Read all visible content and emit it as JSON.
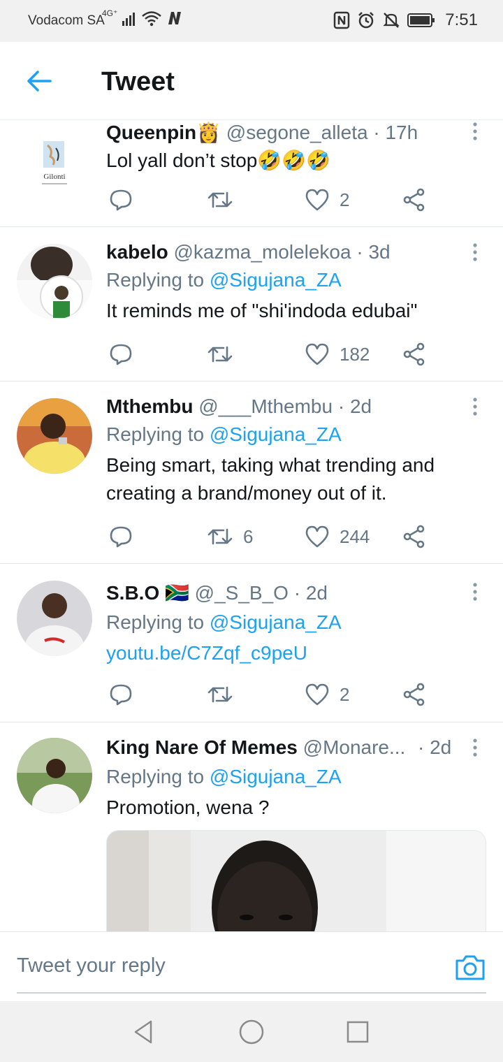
{
  "status_bar": {
    "carrier": "Vodacom SA",
    "network": "4G⁺",
    "time": "7:51",
    "icons": [
      "signal-icon",
      "wifi-icon",
      "app-n-icon",
      "nfc-icon",
      "alarm-icon",
      "mute-icon",
      "battery-icon"
    ]
  },
  "header": {
    "title": "Tweet",
    "back_icon": "arrow-left-icon"
  },
  "colors": {
    "accent": "#1da1f2",
    "muted": "#657786",
    "text": "#14171a",
    "divider": "#e1e8ed"
  },
  "tweets": [
    {
      "name": "Queenpin👸",
      "handle": "@segone_alleta",
      "time": "· 17h",
      "text": "Lol yall don’t stop🤣🤣🤣",
      "avatar_logo": "Gilonti",
      "retweets": "",
      "likes": "2"
    },
    {
      "name": "kabelo",
      "handle": "@kazma_molelekoa",
      "time": "· 3d",
      "replying_prefix": "Replying to",
      "replying_to": "@Sigujana_ZA",
      "text": "It reminds me of \"shi'indoda edubai\"",
      "retweets": "",
      "likes": "182"
    },
    {
      "name": "Mthembu",
      "handle": "@___Mthembu",
      "time": "· 2d",
      "replying_prefix": "Replying to",
      "replying_to": "@Sigujana_ZA",
      "text": "Being smart, taking what trending and creating a brand/money out of it.",
      "retweets": "6",
      "likes": "244"
    },
    {
      "name": "S.B.O 🇿🇦",
      "handle": "@_S_B_O",
      "time": "· 2d",
      "replying_prefix": "Replying to",
      "replying_to": "@Sigujana_ZA",
      "text": "youtu.be/C7Zqf_c9peU",
      "retweets": "",
      "likes": "2"
    },
    {
      "name": "King Nare Of Memes",
      "handle": "@Monare...",
      "time": "· 2d",
      "replying_prefix": "Replying to",
      "replying_to": "@Sigujana_ZA",
      "text": "Promotion, wena ?",
      "has_media": true
    }
  ],
  "reply_bar": {
    "placeholder": "Tweet your reply",
    "camera_icon": "camera-icon"
  },
  "nav_bar": {
    "icons": [
      "back-triangle-icon",
      "home-circle-icon",
      "recents-square-icon"
    ]
  }
}
